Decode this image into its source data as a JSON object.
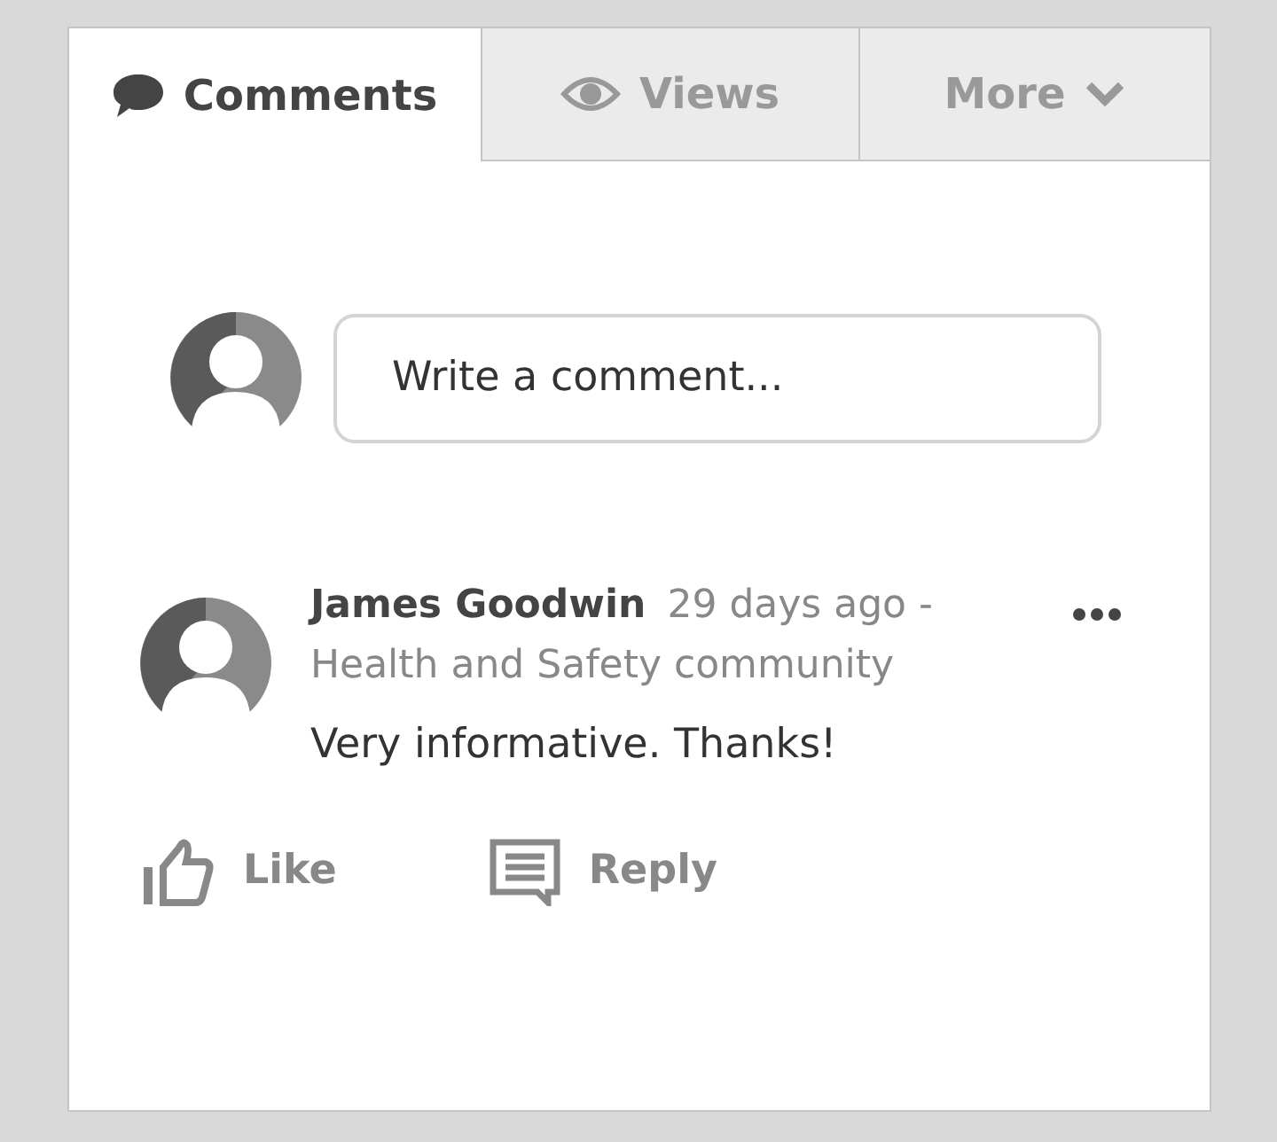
{
  "tabs": [
    {
      "label": "Comments",
      "kind": "comments",
      "selected": true
    },
    {
      "label": "Views",
      "kind": "views",
      "selected": false
    },
    {
      "label": "More",
      "kind": "more",
      "selected": false
    }
  ],
  "composer": {
    "placeholder": "Write a comment..."
  },
  "comments": [
    {
      "author": "James Goodwin",
      "meta": "29 days ago - Health and Safety community",
      "body": "Very informative. Thanks!",
      "actions": [
        {
          "label": "Like",
          "kind": "like"
        },
        {
          "label": "Reply",
          "kind": "reply"
        }
      ]
    }
  ]
}
